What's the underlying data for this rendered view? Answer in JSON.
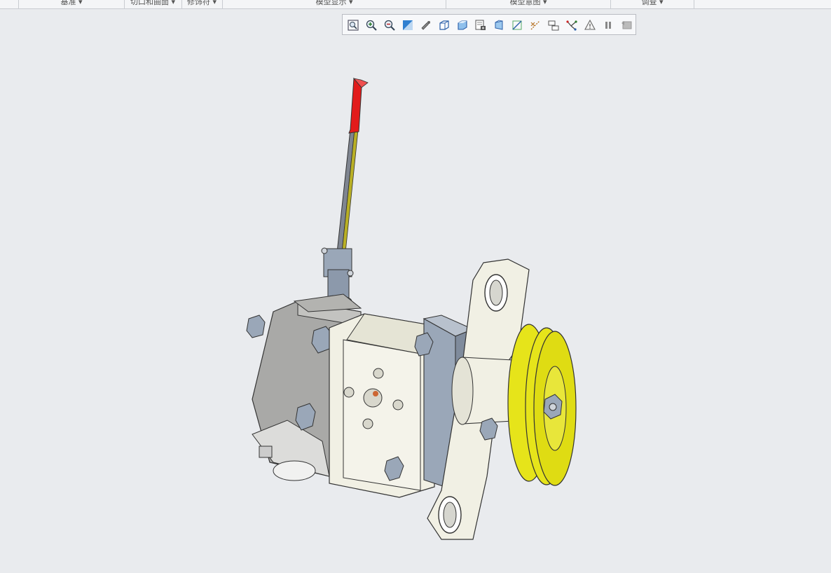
{
  "ribbon": {
    "groups": [
      {
        "label": "基准 ▾"
      },
      {
        "label": "切口和曲面 ▾"
      },
      {
        "label": "修饰符 ▾"
      },
      {
        "label": "模型显示 ▾"
      },
      {
        "label": "模型意图 ▾"
      },
      {
        "label": "调查 ▾"
      }
    ]
  },
  "toolbar": {
    "tools": [
      {
        "icon": "refit-icon"
      },
      {
        "icon": "zoom-in-icon"
      },
      {
        "icon": "zoom-out-icon"
      },
      {
        "icon": "repaint-icon"
      },
      {
        "icon": "spin-center-icon"
      },
      {
        "icon": "saved-orientations-icon"
      },
      {
        "icon": "display-style-icon"
      },
      {
        "icon": "view-manager-icon"
      },
      {
        "icon": "perspective-icon"
      },
      {
        "icon": "datum-planes-icon"
      },
      {
        "icon": "datum-axes-icon"
      },
      {
        "icon": "datum-points-icon"
      },
      {
        "icon": "coordinate-systems-icon"
      },
      {
        "icon": "annotation-display-icon"
      },
      {
        "icon": "pause-icon"
      },
      {
        "icon": "regenerate-icon"
      }
    ]
  },
  "colors": {
    "background": "#e9ebee",
    "handle_tip": "#e21b1b",
    "pulley": "#e6e41a",
    "body": "#f1f0e4",
    "metal": "#9aa7b8",
    "housing": "#a9a9a7"
  }
}
